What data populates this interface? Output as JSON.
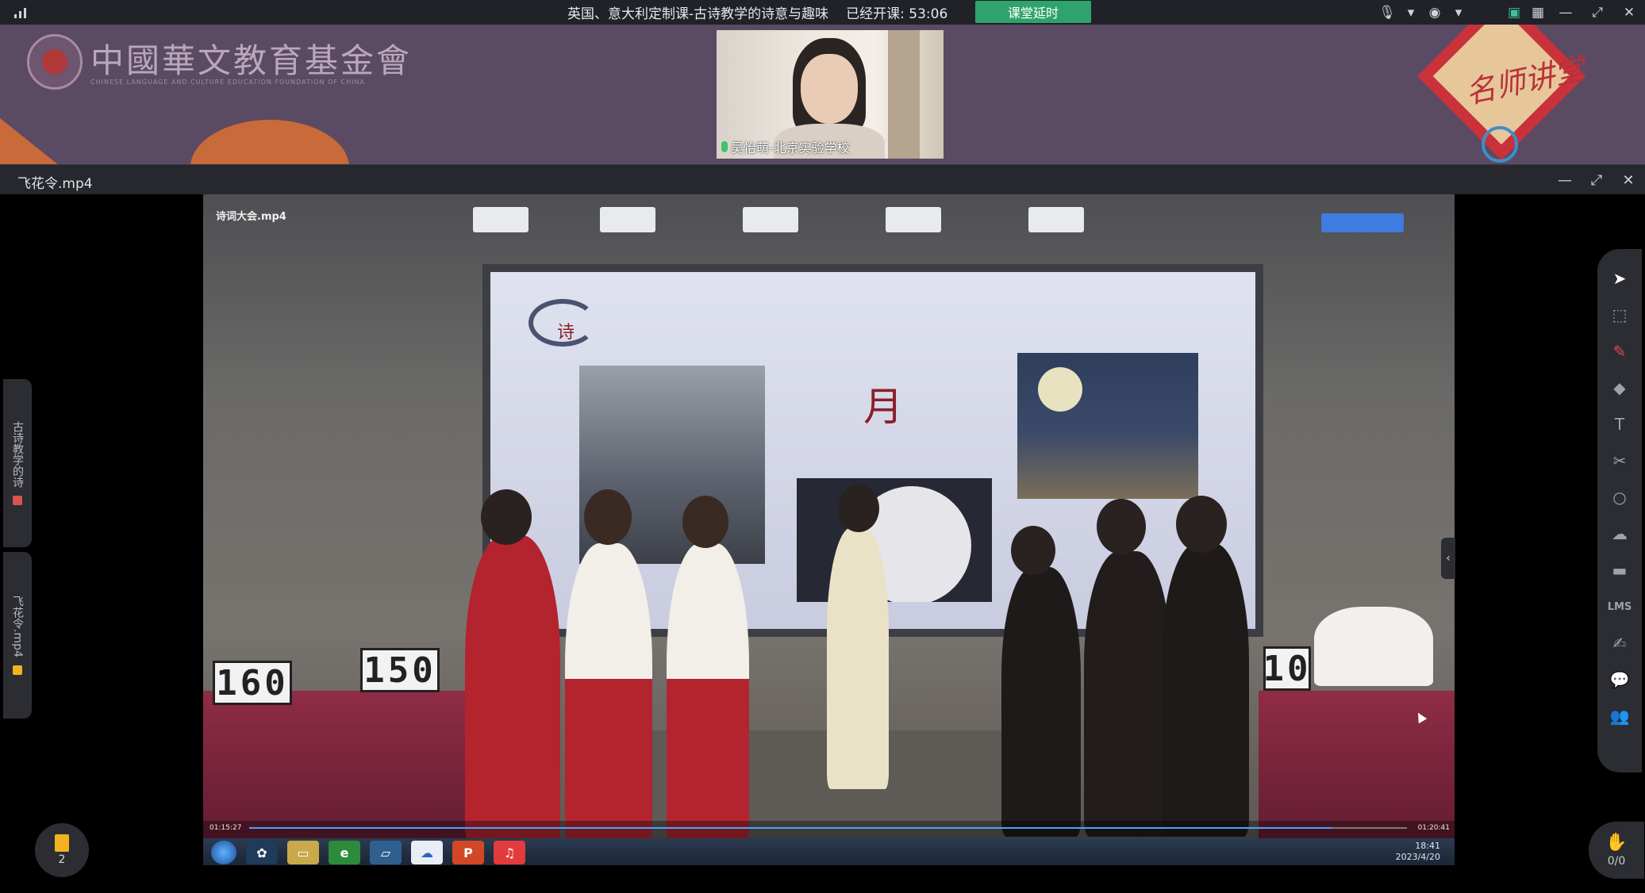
{
  "topbar": {
    "course_title": "英国、意大利定制课-古诗教学的诗意与趣味",
    "elapsed_label": "已经开课: 53:06",
    "extend_button": "课堂延时",
    "icons": [
      "signal-icon",
      "mic-icon",
      "camera-icon",
      "screen-share-icon",
      "grid-layout-icon",
      "minimize-icon",
      "restore-icon",
      "close-icon"
    ]
  },
  "banner": {
    "foundation_name": "中國華文教育基金會",
    "foundation_subtitle": "CHINESE LANGUAGE AND CULTURE EDUCATION FOUNDATION OF CHINA",
    "teacher_caption": "吴怡萌-北京实验学校",
    "badge_text": "名师讲堂"
  },
  "player": {
    "title": "飞花令.mp4",
    "video_label": "诗词大会.mp4",
    "screen_char_poem": "诗",
    "screen_char_moon": "月",
    "score_left": "160",
    "score_mid": "150",
    "score_right": "10",
    "time_current": "01:15:27",
    "time_total": "01:20:41",
    "progress": 0.935,
    "clock_time": "18:41",
    "clock_date": "2023/4/20"
  },
  "left_tabs": [
    {
      "label": "古诗教学的诗",
      "color": "#d9534f"
    },
    {
      "label": "飞花令.mp4",
      "color": "#f2b21f"
    }
  ],
  "files_badge": {
    "count": "2"
  },
  "right_toolbar": {
    "lms_label": "LMS",
    "hand_count": "0/0"
  },
  "colors": {
    "accent_green": "#2fa36c",
    "banner_purple": "#5b4a63",
    "toolbar_bg": "#2b2d33"
  }
}
